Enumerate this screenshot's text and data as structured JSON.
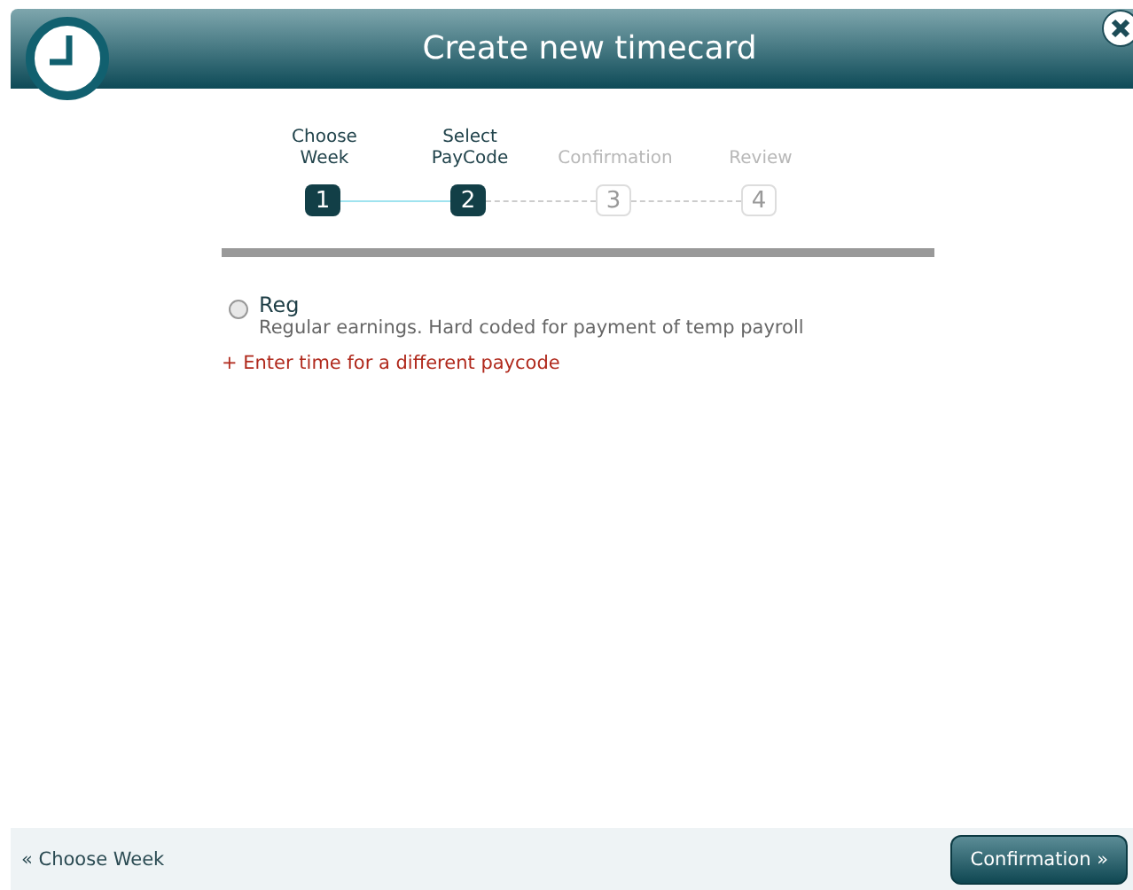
{
  "window": {
    "title": "Create new timecard"
  },
  "steps": [
    {
      "label": "Choose Week",
      "number": "1",
      "reached": true
    },
    {
      "label": "Select PayCode",
      "number": "2",
      "reached": true
    },
    {
      "label": "Confirmation",
      "number": "3",
      "reached": false
    },
    {
      "label": "Review",
      "number": "4",
      "reached": false
    }
  ],
  "paycodes": [
    {
      "name": "Reg",
      "description": "Regular earnings. Hard coded for payment of temp payroll",
      "selected": false
    }
  ],
  "add_link": "+ Enter time for a different paycode",
  "footer": {
    "back": "« Choose Week",
    "next": "Confirmation »"
  }
}
